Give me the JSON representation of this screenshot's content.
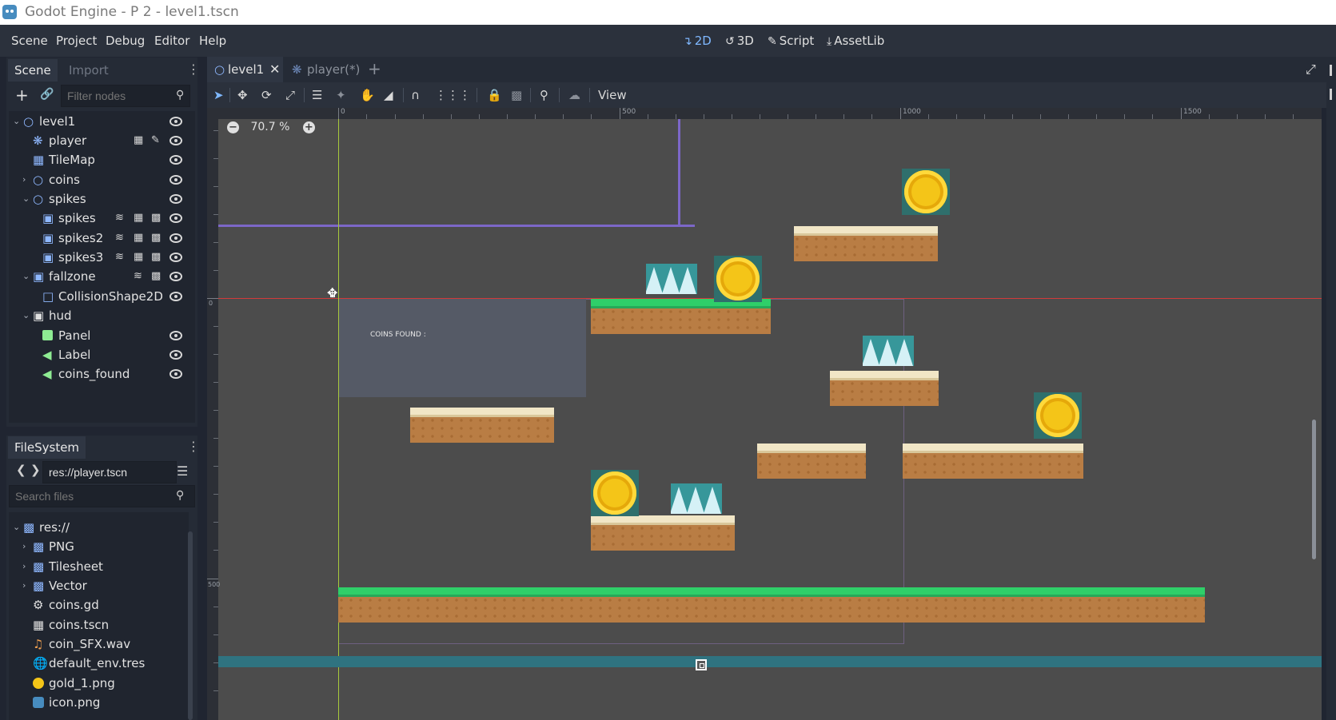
{
  "window": {
    "title": "Godot Engine - P 2 - level1.tscn"
  },
  "menu": [
    "Scene",
    "Project",
    "Debug",
    "Editor",
    "Help"
  ],
  "workspaces": [
    {
      "label": "2D",
      "icon": "2d-icon",
      "active": true
    },
    {
      "label": "3D",
      "icon": "3d-icon",
      "active": false
    },
    {
      "label": "Script",
      "icon": "script-icon",
      "active": false
    },
    {
      "label": "AssetLib",
      "icon": "assetlib-icon",
      "active": false
    }
  ],
  "scene_dock": {
    "tabs": [
      "Scene",
      "Import"
    ],
    "filter_placeholder": "Filter nodes",
    "nodes": [
      {
        "label": "level1",
        "icon": "node2d-icon"
      },
      {
        "label": "player",
        "icon": "kinematic-body-icon"
      },
      {
        "label": "TileMap",
        "icon": "tilemap-icon"
      },
      {
        "label": "coins",
        "icon": "node2d-icon"
      },
      {
        "label": "spikes",
        "icon": "node2d-icon"
      },
      {
        "label": "spikes",
        "icon": "area2d-icon"
      },
      {
        "label": "spikes2",
        "icon": "area2d-icon"
      },
      {
        "label": "spikes3",
        "icon": "area2d-icon"
      },
      {
        "label": "fallzone",
        "icon": "area2d-icon"
      },
      {
        "label": "CollisionShape2D",
        "icon": "collision-shape-icon"
      },
      {
        "label": "hud",
        "icon": "canvas-layer-icon"
      },
      {
        "label": "Panel",
        "icon": "panel-icon"
      },
      {
        "label": "Label",
        "icon": "label-icon"
      },
      {
        "label": "coins_found",
        "icon": "label-icon"
      }
    ]
  },
  "filesystem_dock": {
    "tab": "FileSystem",
    "path": "res://player.tscn",
    "search_placeholder": "Search files",
    "items": [
      {
        "label": "res://",
        "icon": "folder-icon"
      },
      {
        "label": "PNG",
        "icon": "folder-icon"
      },
      {
        "label": "Tilesheet",
        "icon": "folder-icon"
      },
      {
        "label": "Vector",
        "icon": "folder-icon"
      },
      {
        "label": "coins.gd",
        "icon": "gear-script-icon"
      },
      {
        "label": "coins.tscn",
        "icon": "scene-icon"
      },
      {
        "label": "coin_SFX.wav",
        "icon": "audio-icon"
      },
      {
        "label": "default_env.tres",
        "icon": "environment-icon"
      },
      {
        "label": "gold_1.png",
        "icon": "image-icon"
      },
      {
        "label": "icon.png",
        "icon": "image-icon"
      }
    ]
  },
  "editor_tabs": [
    {
      "label": "level1",
      "active": true
    },
    {
      "label": "player(*)",
      "active": false
    }
  ],
  "toolbar": {
    "view_label": "View"
  },
  "viewport": {
    "zoom_label": "70.7 %",
    "hud_text": "COINS FOUND :",
    "ruler_top_labels": [
      "0",
      "500",
      "1000",
      "1500"
    ],
    "ruler_left_labels": [
      "0",
      "500"
    ]
  },
  "colors": {
    "accent": "#7fb8ff",
    "grass": "#2fcf69",
    "dirt": "#b97d44",
    "coin": "#f4c518",
    "guide_red": "#d23a3a",
    "guide_green": "#a8c83c",
    "camera_limit": "#7c67c8"
  }
}
